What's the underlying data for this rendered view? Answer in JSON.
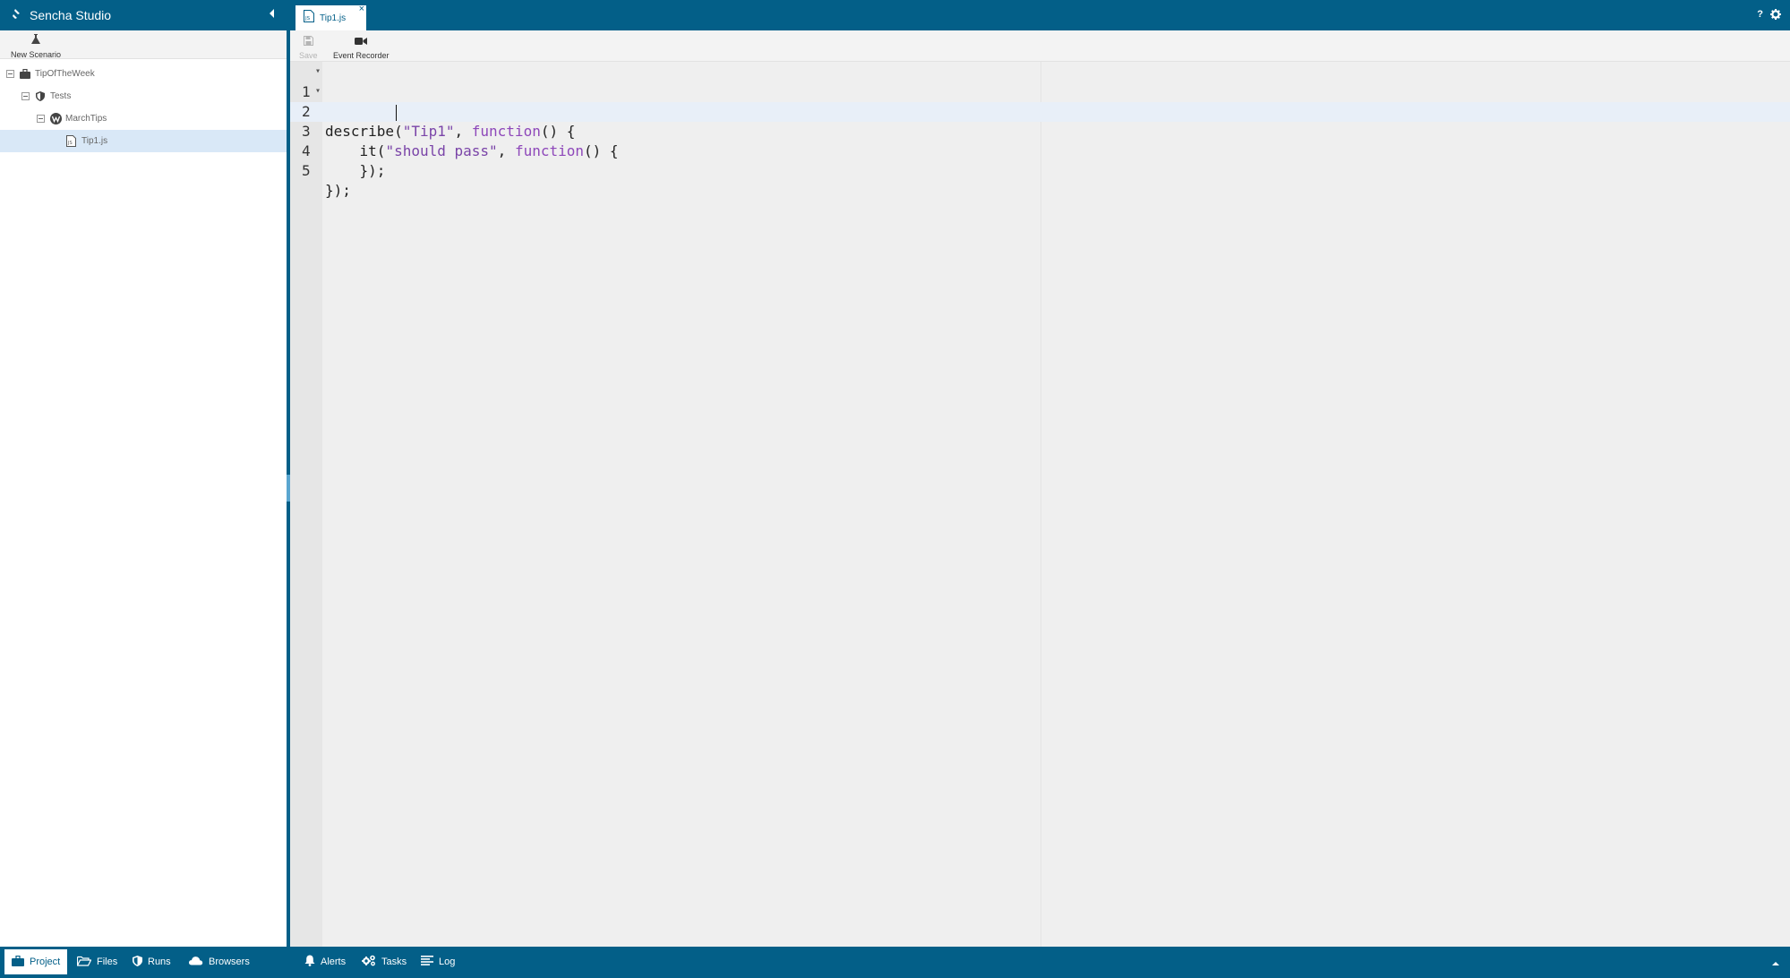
{
  "app": {
    "title": "Sencha Studio"
  },
  "left_toolbar": {
    "new_scenario_label": "New Scenario"
  },
  "tree": {
    "items": [
      {
        "label": "TipOfTheWeek",
        "icon": "briefcase-icon"
      },
      {
        "label": "Tests",
        "icon": "shield-icon"
      },
      {
        "label": "MarchTips",
        "icon": "webdriver-icon"
      },
      {
        "label": "Tip1.js",
        "icon": "js-file-icon",
        "selected": true
      }
    ]
  },
  "left_footer": {
    "tabs": [
      {
        "label": "Project",
        "icon": "briefcase-icon",
        "active": true
      },
      {
        "label": "Files",
        "icon": "folder-open-icon"
      },
      {
        "label": "Runs",
        "icon": "shield-icon"
      },
      {
        "label": "Browsers",
        "icon": "cloud-icon"
      }
    ]
  },
  "editor_tabs": [
    {
      "label": "Tip1.js",
      "close": "×"
    }
  ],
  "header_buttons": {
    "help": "?"
  },
  "editor_toolbar": {
    "save_label": "Save",
    "event_recorder_label": "Event Recorder"
  },
  "code": {
    "lines": [
      {
        "n": "1",
        "text": "describe(\"Tip1\", function() {"
      },
      {
        "n": "2",
        "text": "    it(\"should pass\", function() {"
      },
      {
        "n": "3",
        "text": "        "
      },
      {
        "n": "4",
        "text": "    });"
      },
      {
        "n": "5",
        "text": "});"
      }
    ]
  },
  "right_footer": {
    "tabs": [
      {
        "label": "Alerts",
        "icon": "bell-icon"
      },
      {
        "label": "Tasks",
        "icon": "gears-icon"
      },
      {
        "label": "Log",
        "icon": "list-icon"
      }
    ]
  },
  "colors": {
    "brand": "#035f88",
    "selection": "#d9e8f7",
    "string": "#7a44a8",
    "keyword": "#8e48ba"
  }
}
